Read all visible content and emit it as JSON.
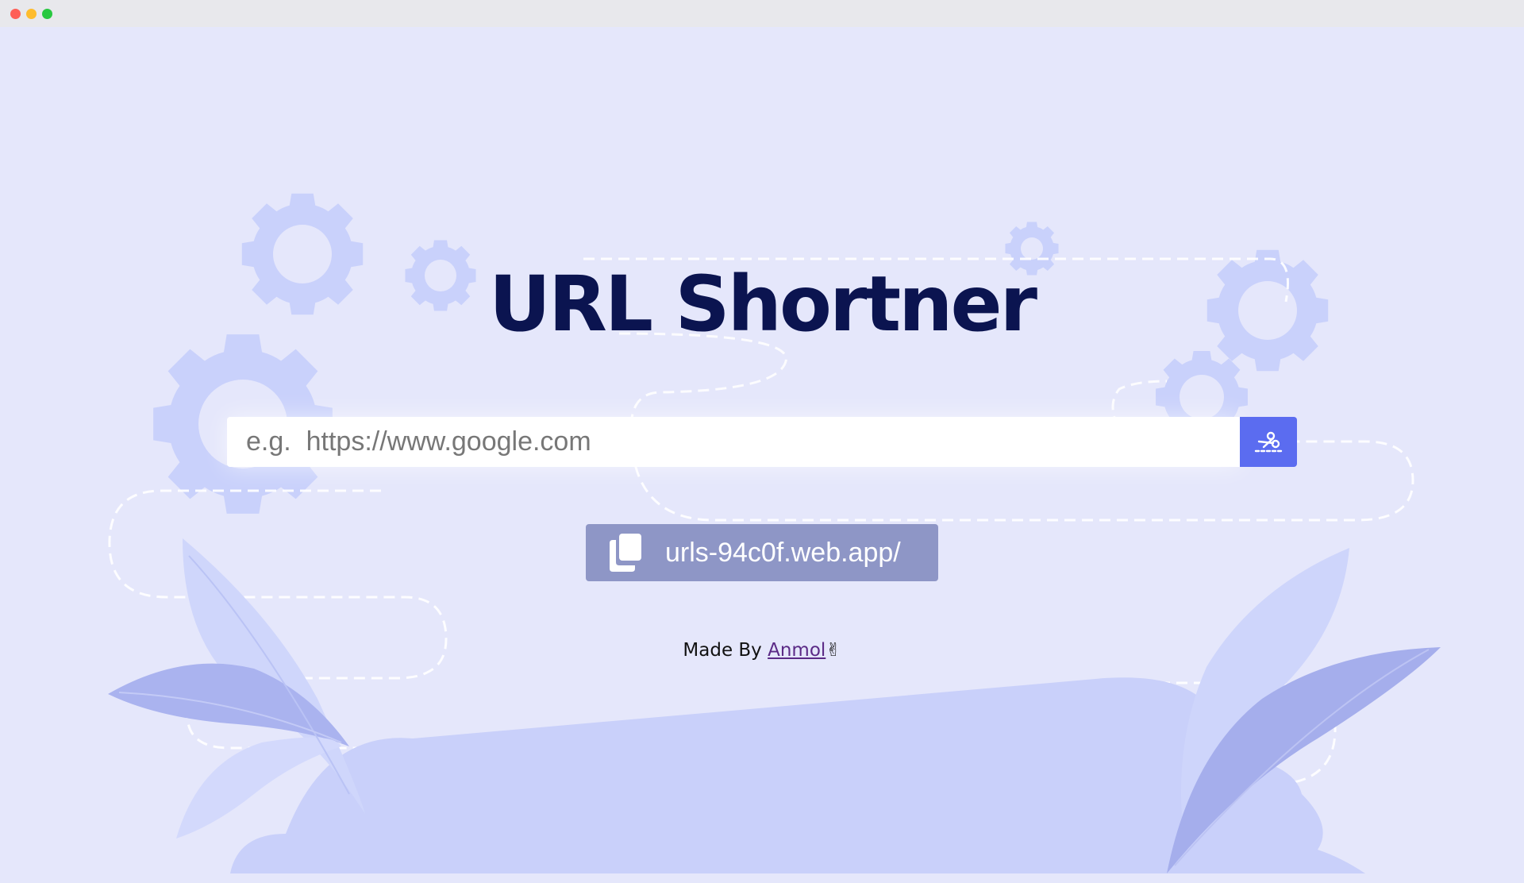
{
  "window": {
    "controls": [
      "close",
      "minimize",
      "maximize"
    ]
  },
  "header": {
    "title": "URL Shortner"
  },
  "search": {
    "placeholder": "e.g.  https://www.google.com",
    "value": "",
    "submit_icon": "scissors-cut-icon"
  },
  "result": {
    "icon": "copy-icon",
    "text": "urls-94c0f.web.app/"
  },
  "footer": {
    "prefix": "Made By ",
    "author": "Anmol",
    "emoji": "✌"
  },
  "colors": {
    "background": "#e5e7fb",
    "title": "#0b1450",
    "accent": "#5b6cf0",
    "result_bg": "#8e96c6",
    "decor": "#c8d0fb"
  }
}
